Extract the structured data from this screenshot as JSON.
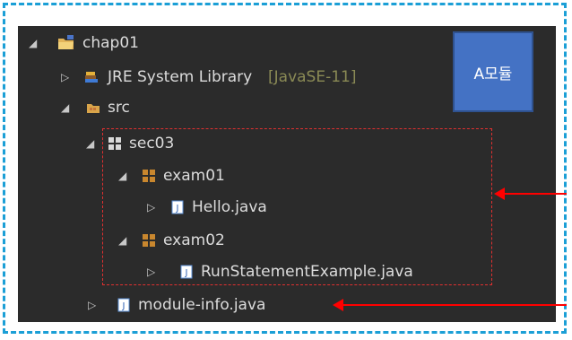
{
  "tree": {
    "project": {
      "label": "chap01"
    },
    "jre": {
      "label": "JRE System Library",
      "decoration": "[JavaSE-11]"
    },
    "src": {
      "label": "src"
    },
    "pkg_sec03": {
      "label": "sec03"
    },
    "pkg_exam01": {
      "label": "exam01"
    },
    "file_hello": {
      "label": "Hello.java"
    },
    "pkg_exam02": {
      "label": "exam02"
    },
    "file_runstmt": {
      "label": "RunStatementExample.java"
    },
    "file_module_info": {
      "label": "module-info.java"
    }
  },
  "annotation": {
    "module_label": "A모듈"
  },
  "colors": {
    "frame": "#1b9fd6",
    "module_box": "#4472c4",
    "arrow": "#ff0000",
    "tree_bg": "#2b2b2b"
  }
}
